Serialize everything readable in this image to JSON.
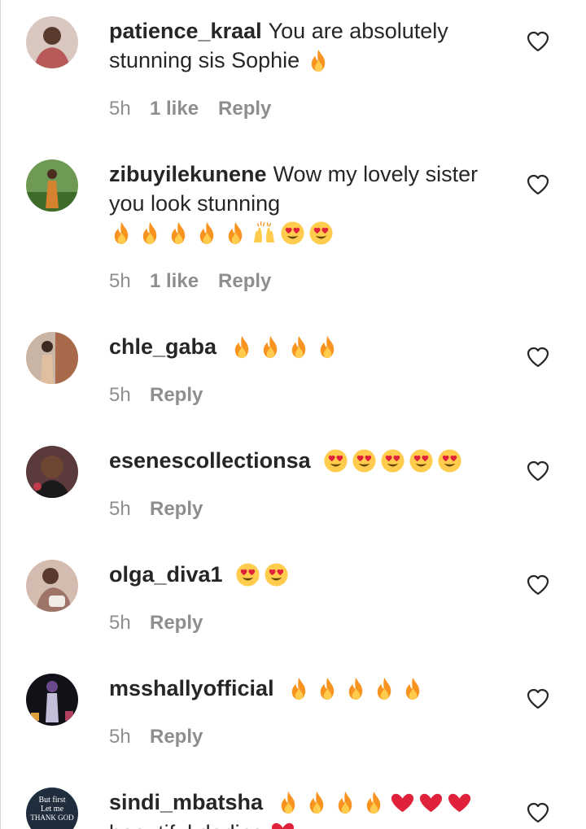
{
  "comments": [
    {
      "username": "patience_kraal",
      "text": "You are absolutely stunning sis Sophie",
      "emojis": [
        "fire-emoji"
      ],
      "time": "5h",
      "likes": "1 like",
      "reply": "Reply",
      "avatar_color": "#b85a5a"
    },
    {
      "username": "zibuyilekunene",
      "text": "Wow my lovely sister you look stunning",
      "emojis": [
        "fire-emoji",
        "fire-emoji",
        "fire-emoji",
        "fire-emoji",
        "fire-emoji",
        "raising-hands-emoji",
        "heart-eyes-emoji",
        "heart-eyes-emoji"
      ],
      "time": "5h",
      "likes": "1 like",
      "reply": "Reply",
      "avatar_color": "#4b7d3a"
    },
    {
      "username": "chle_gaba",
      "text": "",
      "emojis": [
        "fire-emoji",
        "fire-emoji",
        "fire-emoji",
        "fire-emoji"
      ],
      "time": "5h",
      "likes": "",
      "reply": "Reply",
      "avatar_color": "#a8866a"
    },
    {
      "username": "esenescollectionsa",
      "text": "",
      "emojis": [
        "heart-eyes-emoji",
        "heart-eyes-emoji",
        "heart-eyes-emoji",
        "heart-eyes-emoji",
        "heart-eyes-emoji"
      ],
      "time": "5h",
      "likes": "",
      "reply": "Reply",
      "avatar_color": "#5a3a3a"
    },
    {
      "username": "olga_diva1",
      "text": "",
      "emojis": [
        "heart-eyes-emoji",
        "heart-eyes-emoji"
      ],
      "time": "5h",
      "likes": "",
      "reply": "Reply",
      "avatar_color": "#9e7468"
    },
    {
      "username": "msshallyofficial",
      "text": "",
      "emojis": [
        "fire-emoji",
        "fire-emoji",
        "fire-emoji",
        "fire-emoji",
        "fire-emoji"
      ],
      "time": "5h",
      "likes": "",
      "reply": "Reply",
      "avatar_color": "#1a1a2a"
    },
    {
      "username": "sindi_mbatsha",
      "text": "beautiful darling",
      "emojis": [
        "fire-emoji",
        "fire-emoji",
        "fire-emoji",
        "fire-emoji",
        "red-heart-emoji",
        "red-heart-emoji",
        "red-heart-emoji"
      ],
      "time": "",
      "likes": "",
      "reply": "",
      "avatar_color": "#1f2d3d",
      "avatar_text": [
        "But first",
        "Let me",
        "THANK GOD"
      ]
    }
  ],
  "colors": {
    "text": "#262626",
    "secondary": "#8e8e8e",
    "fire": "#f7931e",
    "heart_red": "#e0213a"
  }
}
